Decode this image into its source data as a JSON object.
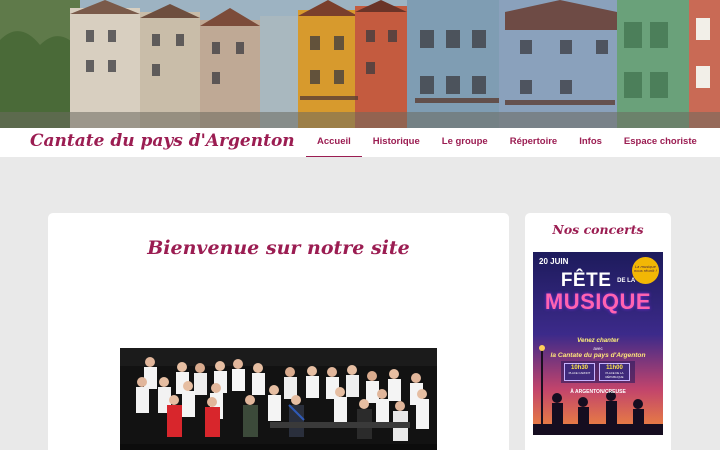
{
  "site": {
    "title": "Cantate du pays d'Argenton"
  },
  "nav": {
    "items": [
      {
        "label": "Accueil",
        "active": true
      },
      {
        "label": "Historique",
        "active": false
      },
      {
        "label": "Le groupe",
        "active": false
      },
      {
        "label": "Répertoire",
        "active": false
      },
      {
        "label": "Infos",
        "active": false
      },
      {
        "label": "Espace choriste",
        "active": false
      }
    ]
  },
  "main": {
    "heading": "Bienvenue sur notre site"
  },
  "sidebar": {
    "heading": "Nos concerts",
    "poster": {
      "date": "20 JUIN",
      "badge": "La musique nous réunit !",
      "fete": "FÊTE",
      "fete_de_la": "DE LA",
      "musique": "MUSIQUE",
      "venez": "Venez chanter",
      "avec": "avec",
      "cantate": "la Cantate du pays d'Argenton",
      "slot1_time": "10h30",
      "slot1_place": "PLACE CARNOT",
      "slot2_time": "11h00",
      "slot2_place": "PLACE DE LA RÉPUBLIQUE",
      "city": "À ARGENTON/CREUSE"
    }
  },
  "colors": {
    "accent": "#9b1d52",
    "page_background": "#e9e9e9",
    "card_background": "#ffffff"
  }
}
